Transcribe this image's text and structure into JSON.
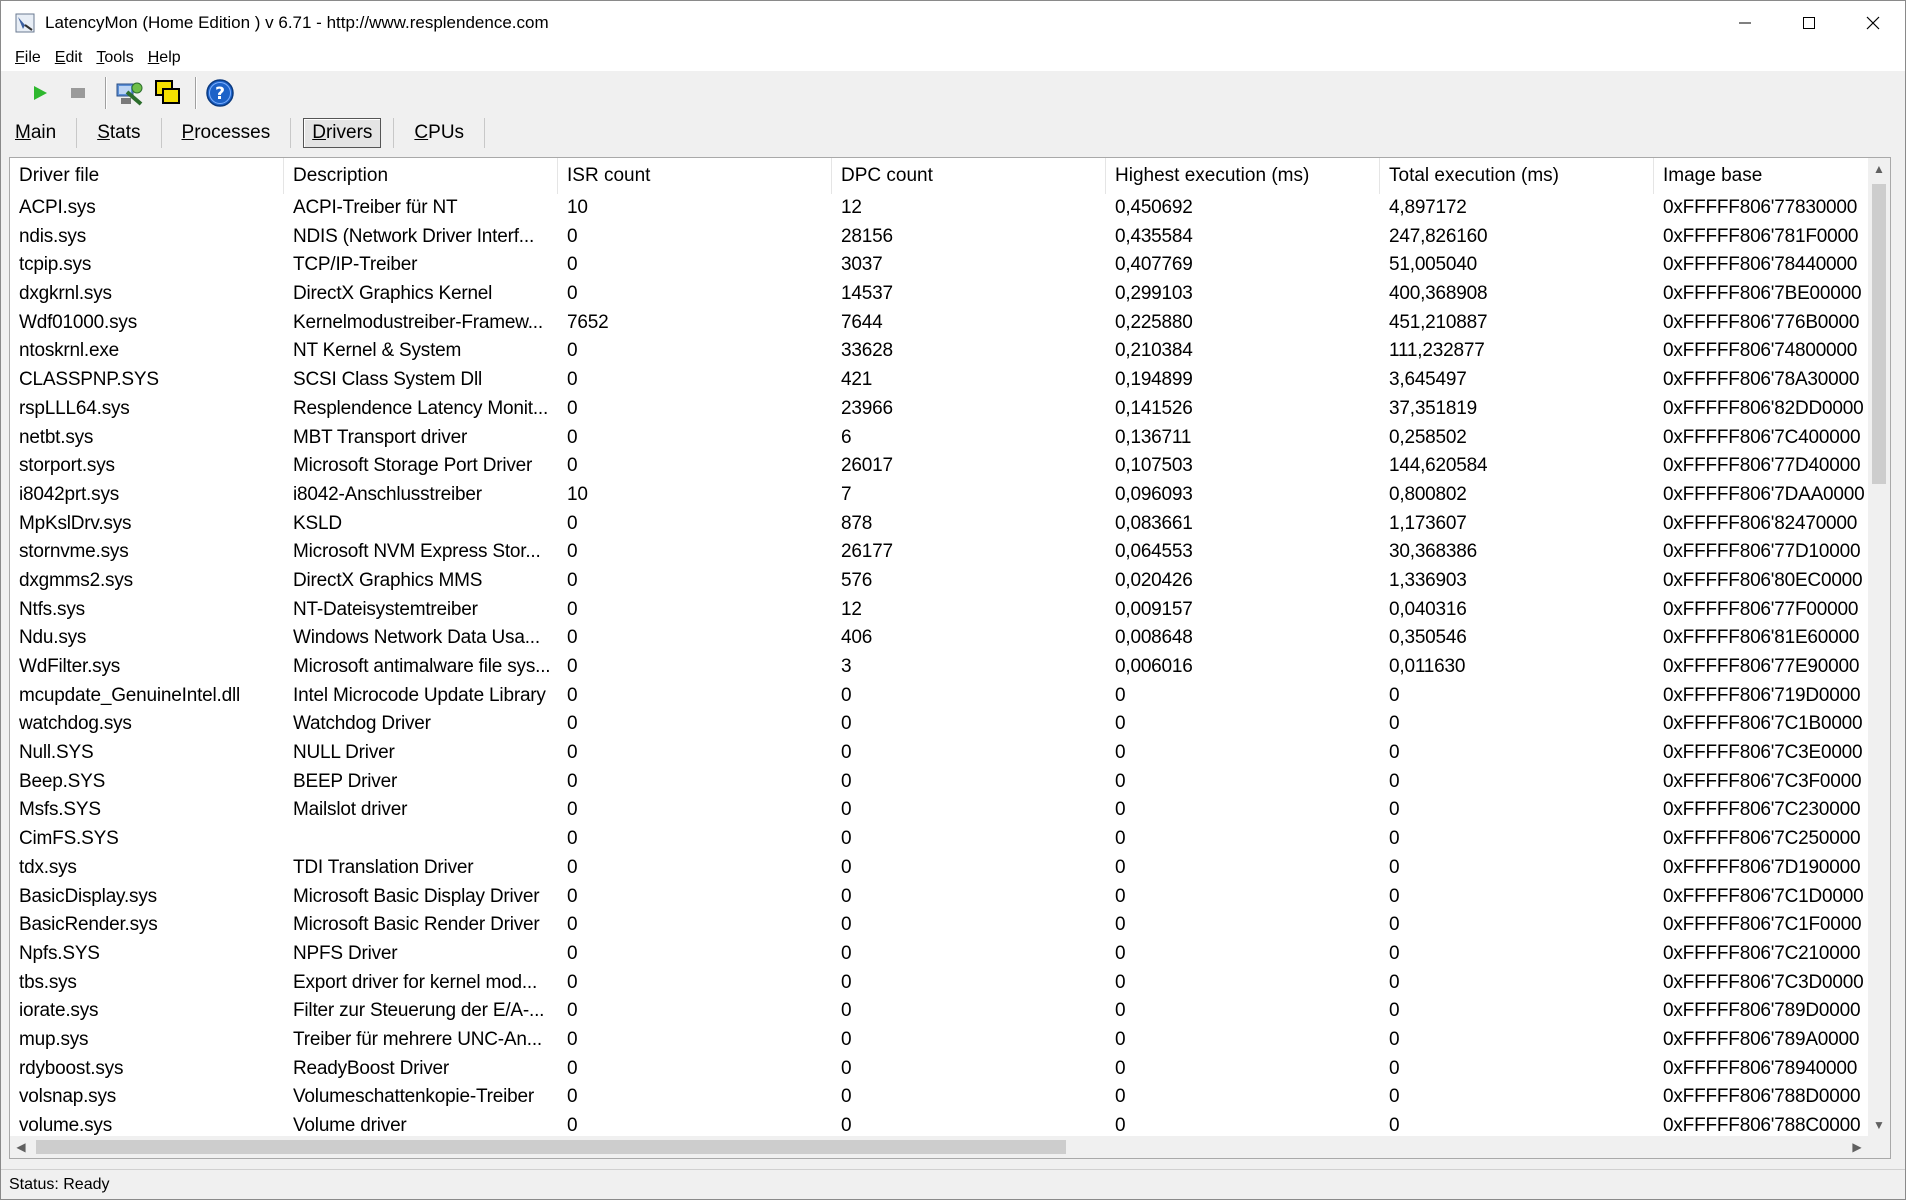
{
  "window": {
    "title": "LatencyMon  (Home Edition )  v 6.71 - http://www.resplendence.com"
  },
  "menu": {
    "items": [
      {
        "label": "File",
        "accel": "F",
        "rest": "ile"
      },
      {
        "label": "Edit",
        "accel": "E",
        "rest": "dit"
      },
      {
        "label": "Tools",
        "accel": "T",
        "rest": "ools"
      },
      {
        "label": "Help",
        "accel": "H",
        "rest": "elp"
      }
    ]
  },
  "toolbar": {
    "buttons": [
      "play-icon",
      "stop-icon",
      "explorer-icon",
      "windows-icon",
      "help-icon"
    ]
  },
  "tabs": [
    {
      "label": "Main",
      "accel": "M",
      "rest": "ain",
      "active": false
    },
    {
      "label": "Stats",
      "accel": "S",
      "rest": "tats",
      "active": false
    },
    {
      "label": "Processes",
      "accel": "P",
      "rest": "rocesses",
      "active": false
    },
    {
      "label": "Drivers",
      "accel": "D",
      "rest": "rivers",
      "active": true
    },
    {
      "label": "CPUs",
      "accel": "C",
      "rest": "PUs",
      "active": false
    }
  ],
  "table": {
    "columns": [
      "Driver file",
      "Description",
      "ISR count",
      "DPC count",
      "Highest execution (ms)",
      "Total execution (ms)",
      "Image base"
    ],
    "rows": [
      [
        "ACPI.sys",
        "ACPI-Treiber für NT",
        "10",
        "12",
        "0,450692",
        "4,897172",
        "0xFFFFF806'77830000"
      ],
      [
        "ndis.sys",
        "NDIS (Network Driver Interf...",
        "0",
        "28156",
        "0,435584",
        "247,826160",
        "0xFFFFF806'781F0000"
      ],
      [
        "tcpip.sys",
        "TCP/IP-Treiber",
        "0",
        "3037",
        "0,407769",
        "51,005040",
        "0xFFFFF806'78440000"
      ],
      [
        "dxgkrnl.sys",
        "DirectX Graphics Kernel",
        "0",
        "14537",
        "0,299103",
        "400,368908",
        "0xFFFFF806'7BE00000"
      ],
      [
        "Wdf01000.sys",
        "Kernelmodustreiber-Framew...",
        "7652",
        "7644",
        "0,225880",
        "451,210887",
        "0xFFFFF806'776B0000"
      ],
      [
        "ntoskrnl.exe",
        "NT Kernel & System",
        "0",
        "33628",
        "0,210384",
        "111,232877",
        "0xFFFFF806'74800000"
      ],
      [
        "CLASSPNP.SYS",
        "SCSI Class System Dll",
        "0",
        "421",
        "0,194899",
        "3,645497",
        "0xFFFFF806'78A30000"
      ],
      [
        "rspLLL64.sys",
        "Resplendence Latency Monit...",
        "0",
        "23966",
        "0,141526",
        "37,351819",
        "0xFFFFF806'82DD0000"
      ],
      [
        "netbt.sys",
        "MBT Transport driver",
        "0",
        "6",
        "0,136711",
        "0,258502",
        "0xFFFFF806'7C400000"
      ],
      [
        "storport.sys",
        "Microsoft Storage Port Driver",
        "0",
        "26017",
        "0,107503",
        "144,620584",
        "0xFFFFF806'77D40000"
      ],
      [
        "i8042prt.sys",
        "i8042-Anschlusstreiber",
        "10",
        "7",
        "0,096093",
        "0,800802",
        "0xFFFFF806'7DAA0000"
      ],
      [
        "MpKslDrv.sys",
        "KSLD",
        "0",
        "878",
        "0,083661",
        "1,173607",
        "0xFFFFF806'82470000"
      ],
      [
        "stornvme.sys",
        "Microsoft NVM Express Stor...",
        "0",
        "26177",
        "0,064553",
        "30,368386",
        "0xFFFFF806'77D10000"
      ],
      [
        "dxgmms2.sys",
        "DirectX Graphics MMS",
        "0",
        "576",
        "0,020426",
        "1,336903",
        "0xFFFFF806'80EC0000"
      ],
      [
        "Ntfs.sys",
        "NT-Dateisystemtreiber",
        "0",
        "12",
        "0,009157",
        "0,040316",
        "0xFFFFF806'77F00000"
      ],
      [
        "Ndu.sys",
        "Windows Network Data Usa...",
        "0",
        "406",
        "0,008648",
        "0,350546",
        "0xFFFFF806'81E60000"
      ],
      [
        "WdFilter.sys",
        "Microsoft antimalware file sys...",
        "0",
        "3",
        "0,006016",
        "0,011630",
        "0xFFFFF806'77E90000"
      ],
      [
        "mcupdate_GenuineIntel.dll",
        "Intel Microcode Update Library",
        "0",
        "0",
        "0",
        "0",
        "0xFFFFF806'719D0000"
      ],
      [
        "watchdog.sys",
        "Watchdog Driver",
        "0",
        "0",
        "0",
        "0",
        "0xFFFFF806'7C1B0000"
      ],
      [
        "Null.SYS",
        "NULL Driver",
        "0",
        "0",
        "0",
        "0",
        "0xFFFFF806'7C3E0000"
      ],
      [
        "Beep.SYS",
        "BEEP Driver",
        "0",
        "0",
        "0",
        "0",
        "0xFFFFF806'7C3F0000"
      ],
      [
        "Msfs.SYS",
        "Mailslot driver",
        "0",
        "0",
        "0",
        "0",
        "0xFFFFF806'7C230000"
      ],
      [
        "CimFS.SYS",
        "",
        "0",
        "0",
        "0",
        "0",
        "0xFFFFF806'7C250000"
      ],
      [
        "tdx.sys",
        "TDI Translation Driver",
        "0",
        "0",
        "0",
        "0",
        "0xFFFFF806'7D190000"
      ],
      [
        "BasicDisplay.sys",
        "Microsoft Basic Display Driver",
        "0",
        "0",
        "0",
        "0",
        "0xFFFFF806'7C1D0000"
      ],
      [
        "BasicRender.sys",
        "Microsoft Basic Render Driver",
        "0",
        "0",
        "0",
        "0",
        "0xFFFFF806'7C1F0000"
      ],
      [
        "Npfs.SYS",
        "NPFS Driver",
        "0",
        "0",
        "0",
        "0",
        "0xFFFFF806'7C210000"
      ],
      [
        "tbs.sys",
        "Export driver for kernel mod...",
        "0",
        "0",
        "0",
        "0",
        "0xFFFFF806'7C3D0000"
      ],
      [
        "iorate.sys",
        "Filter zur Steuerung der E/A-...",
        "0",
        "0",
        "0",
        "0",
        "0xFFFFF806'789D0000"
      ],
      [
        "mup.sys",
        "Treiber für mehrere UNC-An...",
        "0",
        "0",
        "0",
        "0",
        "0xFFFFF806'789A0000"
      ],
      [
        "rdyboost.sys",
        "ReadyBoost Driver",
        "0",
        "0",
        "0",
        "0",
        "0xFFFFF806'78940000"
      ],
      [
        "volsnap.sys",
        "Volumeschattenkopie-Treiber",
        "0",
        "0",
        "0",
        "0",
        "0xFFFFF806'788D0000"
      ],
      [
        "volume.sys",
        "Volume driver",
        "0",
        "0",
        "0",
        "0",
        "0xFFFFF806'788C0000"
      ]
    ]
  },
  "status": {
    "text": "Status: Ready"
  }
}
